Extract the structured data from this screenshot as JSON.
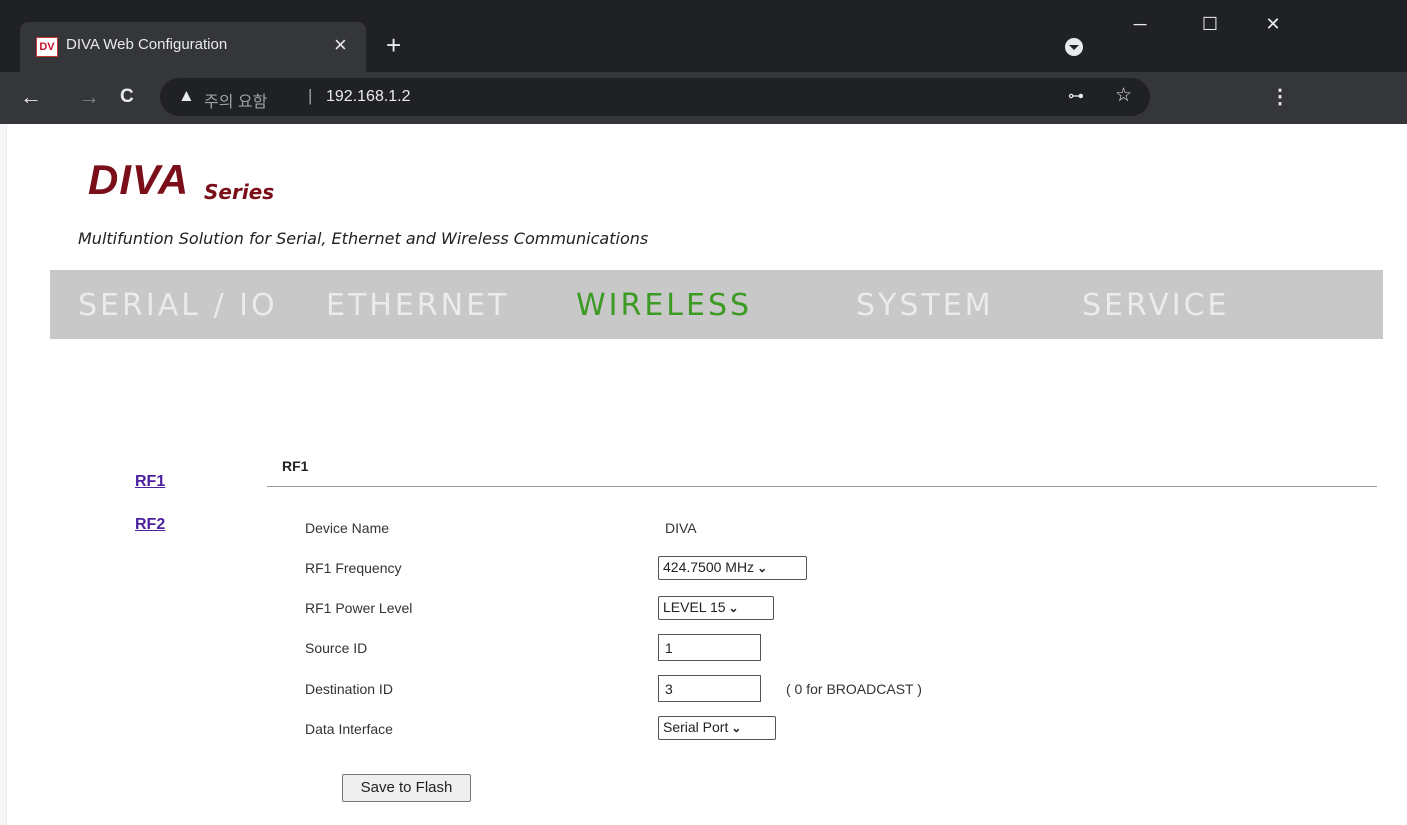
{
  "browser": {
    "tab_title": "DIVA Web Configuration",
    "favicon_text": "DV",
    "tab_close": "×",
    "new_tab": "+",
    "window_minimize": "─",
    "window_maximize": "☐",
    "window_close": "✕",
    "back": "←",
    "forward": "→",
    "reload": "C",
    "security_warning_icon": "▲",
    "security_warning_text": "주의 요함",
    "separator": "|",
    "url": "192.168.1.2",
    "key_icon": "⊶",
    "star_icon": "☆",
    "menu_icon": "⋮"
  },
  "header": {
    "logo_main": "DIVA",
    "logo_sub": "Series",
    "tagline": "Multifuntion Solution for Serial, Ethernet and Wireless Communications"
  },
  "menu": {
    "items": [
      {
        "label": "SERIAL / IO",
        "active": false
      },
      {
        "label": "ETHERNET",
        "active": false
      },
      {
        "label": "WIRELESS",
        "active": true
      },
      {
        "label": "SYSTEM",
        "active": false
      },
      {
        "label": "SERVICE",
        "active": false
      }
    ],
    "active_color": "#3d9a25",
    "inactive_color": "#ebebeb",
    "bar_color": "#c8c8c8"
  },
  "sidebar": {
    "links": [
      "RF1",
      "RF2"
    ]
  },
  "form": {
    "section_title": "RF1",
    "fields": [
      {
        "label": "Device Name",
        "value": "DIVA"
      },
      {
        "label": "RF1 Frequency",
        "value": "424.7500 MHz"
      },
      {
        "label": "RF1 Power Level",
        "value": "LEVEL 15"
      },
      {
        "label": "Source ID",
        "value": "1"
      },
      {
        "label": "Destination ID",
        "value": "3",
        "hint": "( 0 for BROADCAST )"
      },
      {
        "label": "Data Interface",
        "value": "Serial Port"
      }
    ],
    "save_label": "Save to Flash"
  }
}
